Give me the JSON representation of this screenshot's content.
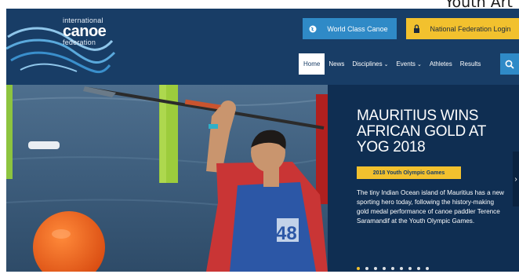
{
  "corner_text": "Youth Art",
  "logo": {
    "line1": "international",
    "line2": "canoe",
    "line3": "federation"
  },
  "top_buttons": {
    "world_class": "World Class Canoe",
    "federation_login": "National Federation Login"
  },
  "nav": {
    "items": [
      {
        "label": "Home",
        "active": true
      },
      {
        "label": "News"
      },
      {
        "label": "Disciplines",
        "dropdown": true
      },
      {
        "label": "Events",
        "dropdown": true
      },
      {
        "label": "Athletes"
      },
      {
        "label": "Results"
      }
    ]
  },
  "hero": {
    "headline": "MAURITIUS WINS AFRICAN GOLD AT YOG 2018",
    "tag": "2018 Youth Olympic Games",
    "summary": "The tiny Indian Ocean island of Mauritius has a new sporting hero today, following the history-making gold medal performance of canoe paddler Terence Saramandif at the Youth Olympic Games.",
    "slide_count": 9,
    "active_slide": 1,
    "bib_number": "48"
  },
  "colors": {
    "navy": "#183d66",
    "blue": "#2f8ac7",
    "yellow": "#f2c12e"
  },
  "icons": {
    "world_class": "globe-icon",
    "login": "lock-icon",
    "search": "search-icon"
  }
}
